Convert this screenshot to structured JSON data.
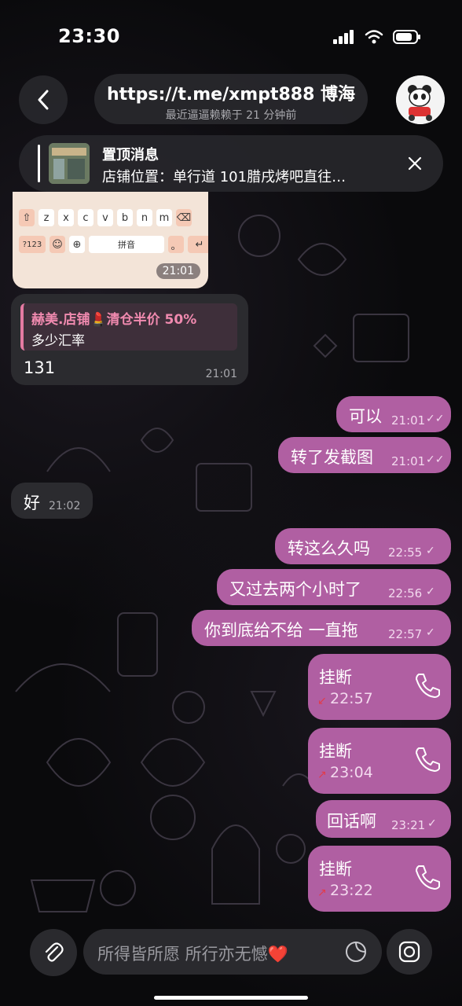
{
  "status": {
    "time": "23:30"
  },
  "header": {
    "title": "https://t.me/xmpt888 博海",
    "subtitle": "最近逼逼赖赖于 21 分钟前"
  },
  "pinned": {
    "title": "置顶消息",
    "text": "店铺位置：单行道 101腊戌烤吧直往…"
  },
  "keyboard_image": {
    "row1": [
      "z",
      "x",
      "c",
      "v",
      "b",
      "n",
      "m"
    ],
    "row2_left": "?123",
    "row2_mid": "拼音",
    "row2_right": "。",
    "time": "21:01"
  },
  "messages": {
    "m1": {
      "reply_name": "赫美.店铺💄清仓半价 50%",
      "reply_text": "多少汇率",
      "text": "131",
      "time": "21:01"
    },
    "m2": {
      "text": "可以",
      "time": "21:01"
    },
    "m3": {
      "text": "转了发截图",
      "time": "21:01"
    },
    "m4": {
      "text": "好",
      "time": "21:02"
    },
    "m5": {
      "text": "转这么久吗",
      "time": "22:55"
    },
    "m6": {
      "text": "又过去两个小时了",
      "time": "22:56"
    },
    "m7": {
      "text": "你到底给不给 一直拖",
      "time": "22:57"
    },
    "c1": {
      "title": "挂断",
      "time": "22:57"
    },
    "c2": {
      "title": "挂断",
      "time": "23:04"
    },
    "m8": {
      "text": "回话啊",
      "time": "23:21"
    },
    "c3": {
      "title": "挂断",
      "time": "23:22"
    }
  },
  "composer": {
    "placeholder": "所得皆所愿 所行亦无憾❤️"
  },
  "colors": {
    "outgoing": "#b05fa2",
    "incoming": "#2b2b2f",
    "accent": "#f08aaf"
  }
}
